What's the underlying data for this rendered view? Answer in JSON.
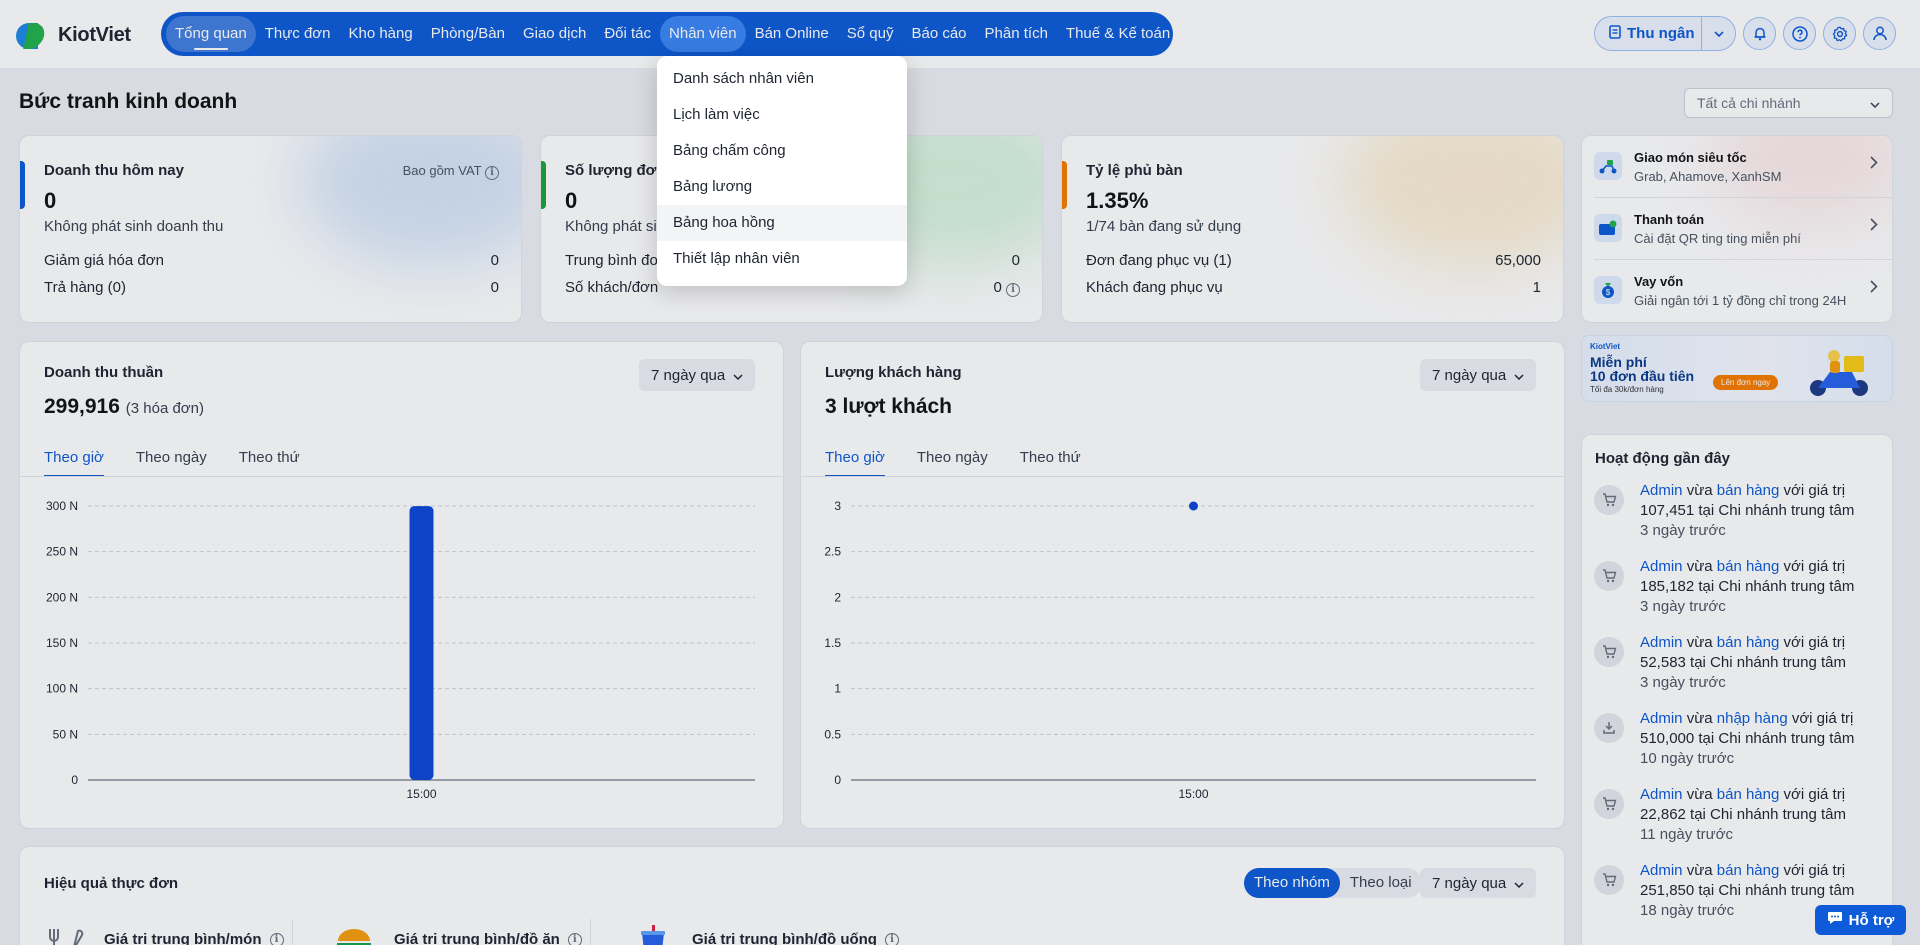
{
  "app": {
    "brand": "KiotViet"
  },
  "nav": {
    "items": [
      "Tổng quan",
      "Thực đơn",
      "Kho hàng",
      "Phòng/Bàn",
      "Giao dịch",
      "Đối tác",
      "Nhân viên",
      "Bán Online",
      "Sổ quỹ",
      "Báo cáo",
      "Phân tích",
      "Thuế & Kế toán"
    ],
    "active": "Tổng quan",
    "open": "Nhân viên"
  },
  "header": {
    "cashier_label": "Thu ngân"
  },
  "page": {
    "title": "Bức tranh kinh doanh",
    "branch_select": "Tất cả chi nhánh"
  },
  "stats": {
    "revenue_today": {
      "title": "Doanh thu hôm nay",
      "vat": "Bao gồm VAT",
      "value": "0",
      "sub": "Không phát sinh doanh thu",
      "rows": [
        {
          "label": "Giảm giá hóa đơn",
          "value": "0"
        },
        {
          "label": "Trả hàng (0)",
          "value": "0"
        }
      ]
    },
    "orders": {
      "title": "Số lượng đơn",
      "value": "0",
      "sub": "Không phát sinh",
      "rows": [
        {
          "label": "Trung bình đơn",
          "value": "0"
        },
        {
          "label": "Số khách/đơn",
          "value": "0"
        }
      ]
    },
    "occupancy": {
      "title": "Tỷ lệ phủ bàn",
      "value": "1.35%",
      "sub": "1/74 bàn đang sử dụng",
      "rows": [
        {
          "label": "Đơn đang phục vụ (1)",
          "value": "65,000"
        },
        {
          "label": "Khách đang phục vụ",
          "value": "1"
        }
      ]
    }
  },
  "promos": [
    {
      "title": "Giao món siêu tốc",
      "sub": "Grab, Ahamove, XanhSM"
    },
    {
      "title": "Thanh toán",
      "sub": "Cài đặt QR ting ting miễn phí"
    },
    {
      "title": "Vay vốn",
      "sub": "Giải ngân tới 1 tỷ đồng chỉ trong 24H"
    }
  ],
  "banner": {
    "brand": "KiotViet",
    "line1": "Miễn phí",
    "line2": "10 đơn đầu tiên",
    "line3": "Tối đa 30k/đơn hàng",
    "cta": "Lên đơn ngay"
  },
  "revenue_chart": {
    "title": "Doanh thu thuần",
    "period": "7 ngày qua",
    "value": "299,916",
    "value_note": "(3 hóa đơn)",
    "tabs": [
      "Theo giờ",
      "Theo ngày",
      "Theo thứ"
    ]
  },
  "customer_chart": {
    "title": "Lượng khách hàng",
    "period": "7 ngày qua",
    "value": "3 lượt khách",
    "tabs": [
      "Theo giờ",
      "Theo ngày",
      "Theo thứ"
    ]
  },
  "chart_data": [
    {
      "type": "bar",
      "categories": [
        "15:00"
      ],
      "values": [
        299916
      ],
      "yticks": [
        "0",
        "50 N",
        "100 N",
        "150 N",
        "200 N",
        "250 N",
        "300 N"
      ],
      "ylim": [
        0,
        300000
      ],
      "color": "#0d47d9"
    },
    {
      "type": "scatter",
      "x": [
        "15:00"
      ],
      "values": [
        3
      ],
      "yticks": [
        "0",
        "0.5",
        "1",
        "1.5",
        "2",
        "2.5",
        "3"
      ],
      "ylim": [
        0,
        3
      ],
      "color": "#0d47d9"
    }
  ],
  "activity": {
    "title": "Hoạt động gần đây",
    "items": [
      {
        "user": "Admin",
        "verb": "vừa",
        "action": "bán hàng",
        "rest": "với giá trị",
        "line2": "107,451 tại Chi nhánh trung tâm",
        "time": "3 ngày trước"
      },
      {
        "user": "Admin",
        "verb": "vừa",
        "action": "bán hàng",
        "rest": "với giá trị",
        "line2": "185,182 tại Chi nhánh trung tâm",
        "time": "3 ngày trước"
      },
      {
        "user": "Admin",
        "verb": "vừa",
        "action": "bán hàng",
        "rest": "với giá trị",
        "line2": "52,583 tại Chi nhánh trung tâm",
        "time": "3 ngày trước"
      },
      {
        "user": "Admin",
        "verb": "vừa",
        "action": "nhập hàng",
        "rest": "với giá trị",
        "line2": "510,000 tại Chi nhánh trung tâm",
        "time": "10 ngày trước"
      },
      {
        "user": "Admin",
        "verb": "vừa",
        "action": "bán hàng",
        "rest": "với giá trị",
        "line2": "22,862 tại Chi nhánh trung tâm",
        "time": "11 ngày trước"
      },
      {
        "user": "Admin",
        "verb": "vừa",
        "action": "bán hàng",
        "rest": "với giá trị",
        "line2": "251,850 tại Chi nhánh trung tâm",
        "time": "18 ngày trước"
      }
    ]
  },
  "menu_perf": {
    "title": "Hiệu quả thực đơn",
    "seg": [
      "Theo nhóm",
      "Theo loại"
    ],
    "seg_active": "Theo nhóm",
    "period": "7 ngày qua",
    "metrics": [
      "Giá trị trung bình/món",
      "Giá trị trung bình/đồ ăn",
      "Giá trị trung bình/đồ uống"
    ]
  },
  "dropdown": {
    "items": [
      "Danh sách nhân viên",
      "Lịch làm việc",
      "Bảng chấm công",
      "Bảng lương",
      "Bảng hoa hồng",
      "Thiết lập nhân viên"
    ],
    "hover": "Bảng hoa hồng"
  },
  "support": {
    "label": "Hỗ trợ"
  }
}
